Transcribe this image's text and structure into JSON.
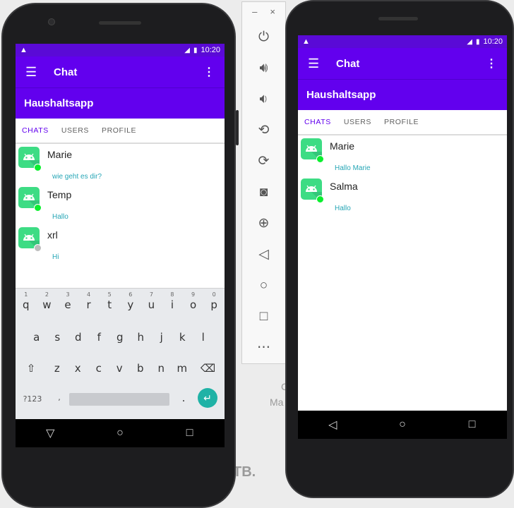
{
  "background": {
    "letters": "TB.",
    "fragment_ma": "Ma",
    "fragment_c": "C"
  },
  "left_phone": {
    "status_time": "10:20",
    "app_title": "Chat",
    "subtitle": "Haushaltsapp",
    "tabs": [
      "CHATS",
      "USERS",
      "PROFILE"
    ],
    "active_tab": "CHATS",
    "chats": [
      {
        "name": "Marie",
        "message": "wie geht es dir?",
        "online": true
      },
      {
        "name": "Temp",
        "message": "Hallo",
        "online": true
      },
      {
        "name": "xrl",
        "message": "Hi",
        "online": false
      }
    ],
    "keyboard": {
      "row1": [
        "q",
        "w",
        "e",
        "r",
        "t",
        "y",
        "u",
        "i",
        "o",
        "p"
      ],
      "row1_hints": [
        "1",
        "2",
        "3",
        "4",
        "5",
        "6",
        "7",
        "8",
        "9",
        "0"
      ],
      "row2": [
        "a",
        "s",
        "d",
        "f",
        "g",
        "h",
        "j",
        "k",
        "l"
      ],
      "row3": [
        "z",
        "x",
        "c",
        "v",
        "b",
        "n",
        "m"
      ],
      "symbols_key": "?123",
      "period_key": "."
    }
  },
  "right_phone": {
    "status_time": "10:20",
    "app_title": "Chat",
    "subtitle": "Haushaltsapp",
    "tabs": [
      "CHATS",
      "USERS",
      "PROFILE"
    ],
    "active_tab": "CHATS",
    "chats": [
      {
        "name": "Marie",
        "message": "Hallo Marie",
        "online": true
      },
      {
        "name": "Salma",
        "message": "Hallo",
        "online": true
      }
    ]
  },
  "emulator_toolbar": {
    "tools": [
      "power-icon",
      "volume-up-icon",
      "volume-down-icon",
      "rotate-left-icon",
      "rotate-right-icon",
      "camera-icon",
      "zoom-icon",
      "back-icon",
      "home-icon",
      "overview-icon",
      "more-icon"
    ]
  },
  "colors": {
    "app_bar": "#6200ee",
    "status_bar": "#5a0ad6",
    "accent_text": "#26a6b6",
    "online": "#0aef2e",
    "avatar_green": "#3ddc84"
  }
}
